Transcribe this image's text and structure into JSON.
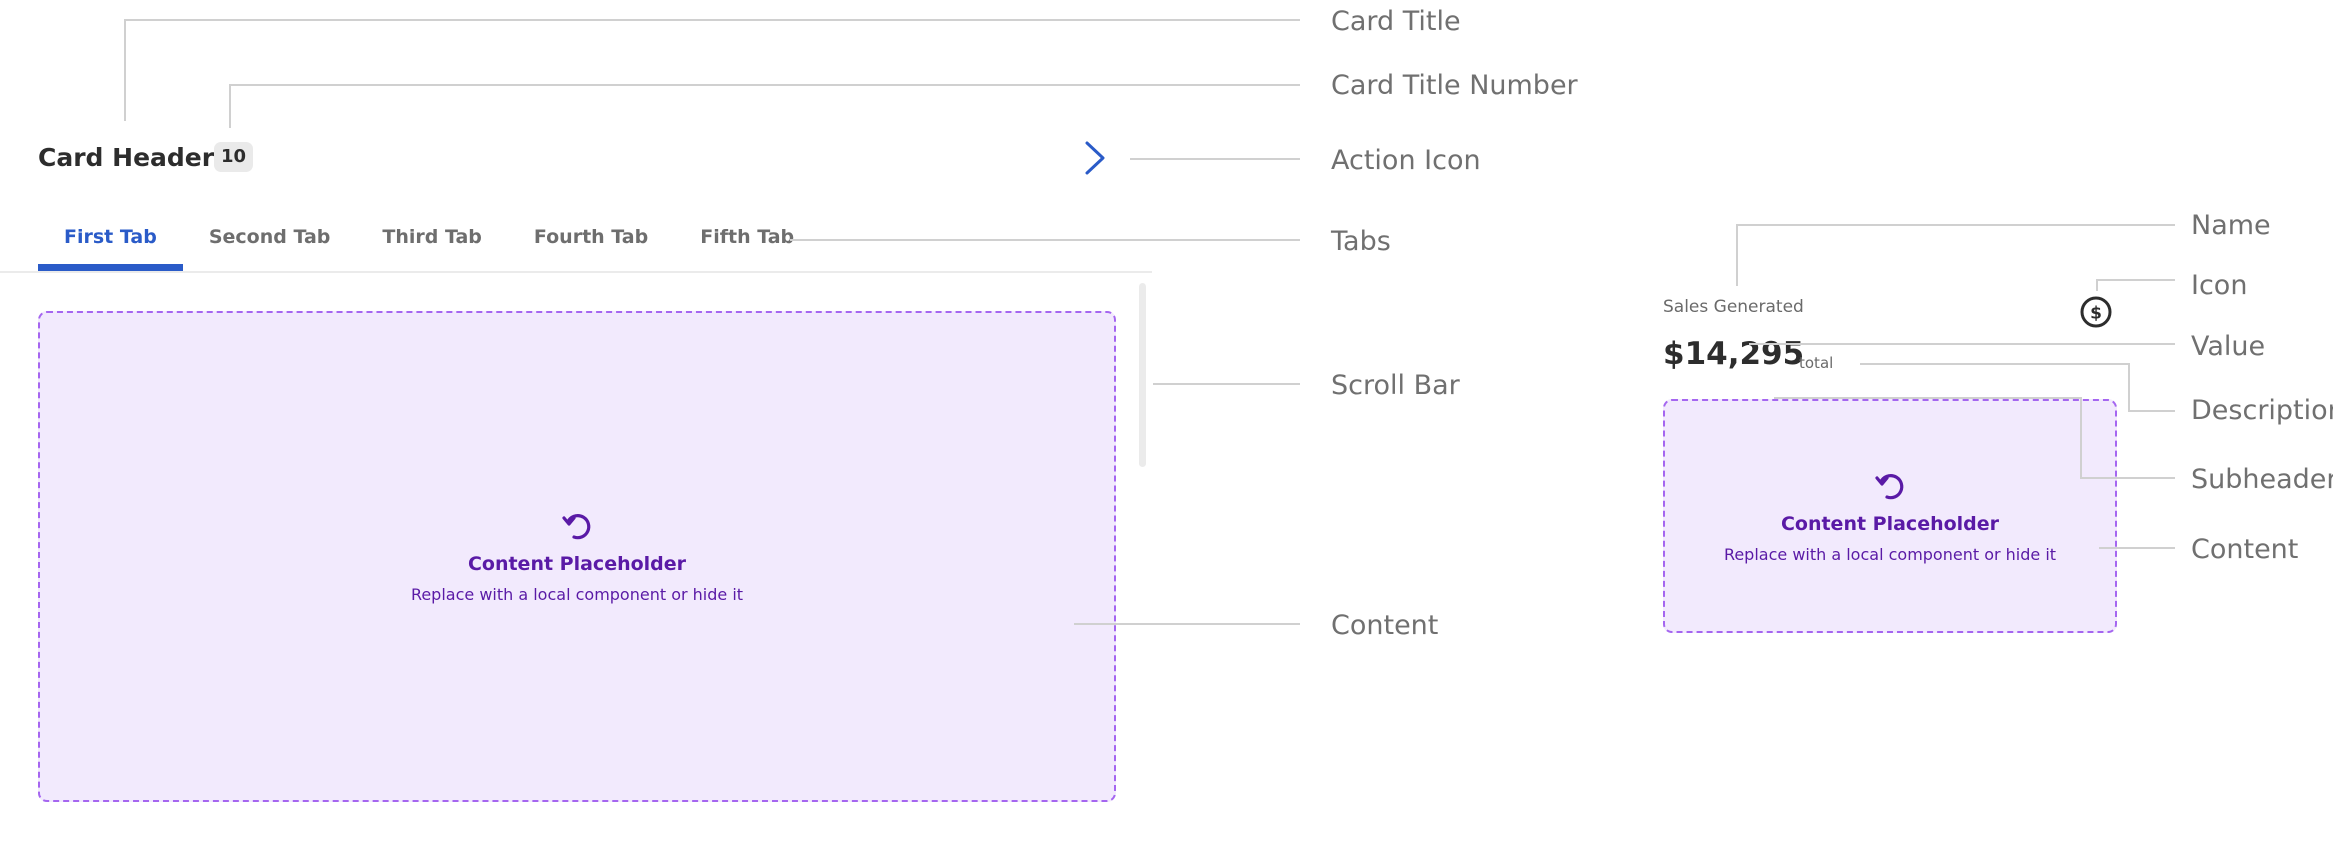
{
  "annotations": {
    "card_title": "Card Title",
    "card_title_number": "Card Title Number",
    "action_icon": "Action Icon",
    "tabs": "Tabs",
    "scroll_bar": "Scroll Bar",
    "content_left": "Content",
    "name": "Name",
    "icon": "Icon",
    "value": "Value",
    "description": "Description",
    "subheader": "Subheader",
    "content_right": "Content"
  },
  "card": {
    "title": "Card Header",
    "title_number": "10",
    "action_icon": "chevron-right-icon",
    "tabs": [
      {
        "label": "First Tab",
        "active": true
      },
      {
        "label": "Second Tab",
        "active": false
      },
      {
        "label": "Third Tab",
        "active": false
      },
      {
        "label": "Fourth Tab",
        "active": false
      },
      {
        "label": "Fifth Tab",
        "active": false
      }
    ],
    "content": {
      "icon": "refresh-icon",
      "title": "Content Placeholder",
      "subtitle": "Replace with a local component or hide it"
    }
  },
  "kpi": {
    "name": "Sales Generated",
    "icon": "dollar-circle-icon",
    "value": "$14,295",
    "description": "total",
    "content": {
      "icon": "refresh-icon",
      "title": "Content Placeholder",
      "subtitle": "Replace with a local component or hide it"
    }
  },
  "colors": {
    "accent": "#2a5bc8",
    "placeholder_bg": "#f2eafd",
    "placeholder_border": "#a566f0",
    "placeholder_text": "#5a1aa6",
    "annotation_line": "#d0d0d0",
    "annotation_text": "#707070"
  }
}
